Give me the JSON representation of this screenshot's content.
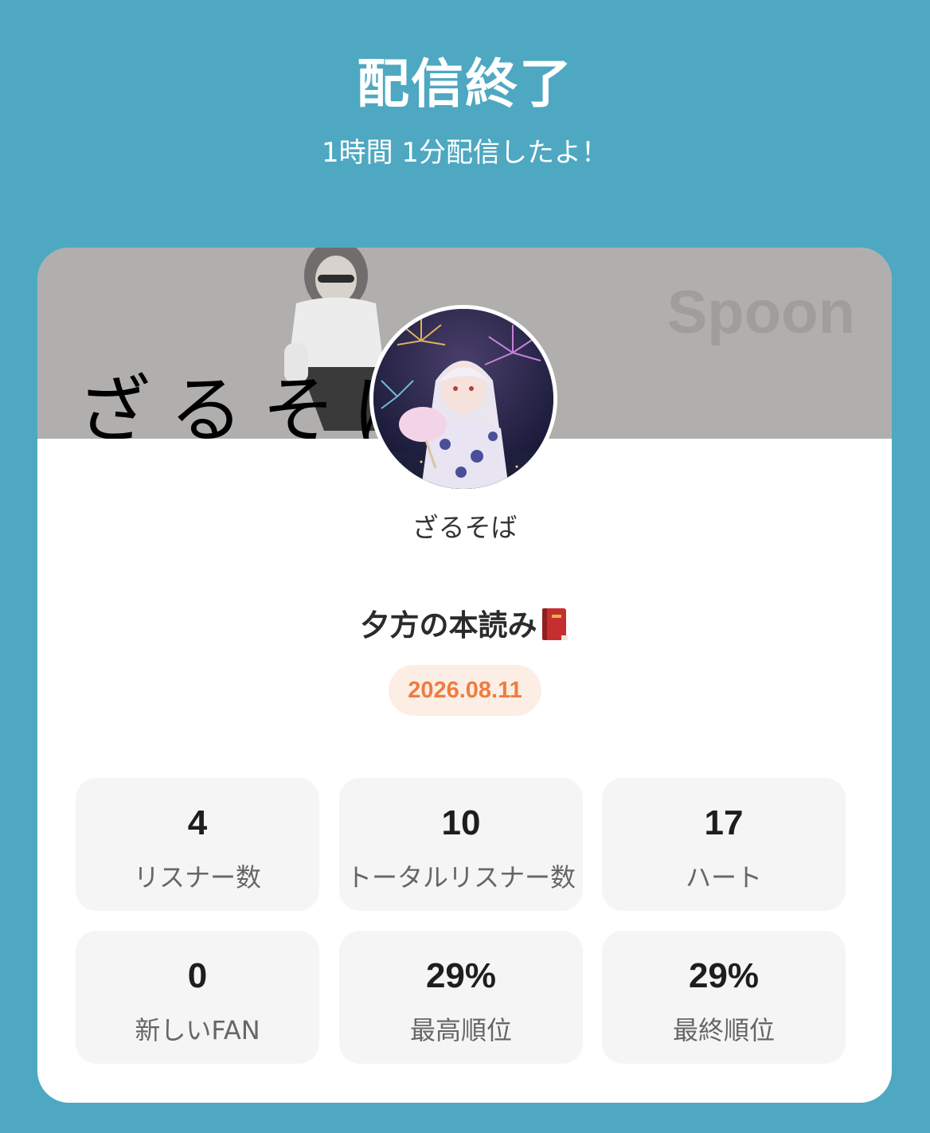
{
  "header": {
    "title": "配信終了",
    "subtitle": "1時間 1分配信したよ！"
  },
  "banner": {
    "text": "ざるそば",
    "logo": "Spoon"
  },
  "profile": {
    "name": "ざるそば"
  },
  "live": {
    "title": "夕方の本読み",
    "date": "2026.08.11"
  },
  "stats": [
    {
      "value": "4",
      "label": "リスナー数"
    },
    {
      "value": "10",
      "label": "トータルリスナー数"
    },
    {
      "value": "17",
      "label": "ハート"
    },
    {
      "value": "0",
      "label": "新しいFAN"
    },
    {
      "value": "29%",
      "label": "最高順位"
    },
    {
      "value": "29%",
      "label": "最終順位"
    }
  ],
  "colors": {
    "background": "#4ea8c1",
    "card": "#ffffff",
    "banner": "#b0afae",
    "date_text": "#ef7c3f",
    "date_bg": "#fdeee5",
    "stat_bg": "#f5f5f5"
  }
}
